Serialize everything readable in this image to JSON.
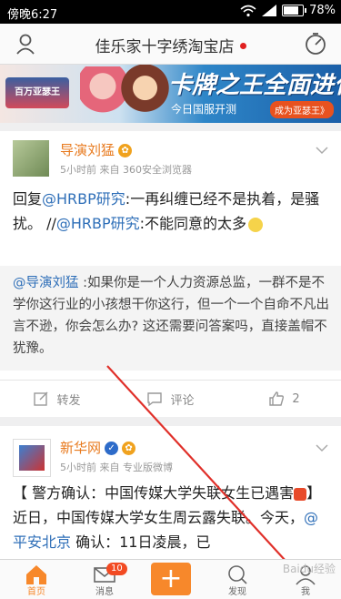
{
  "status_bar": {
    "time": "傍晚6:27",
    "battery": "78%"
  },
  "header": {
    "title": "佳乐家十字绣淘宝店"
  },
  "banner": {
    "logo_text": "百万亚瑟王",
    "title": "卡牌之王全面进化",
    "subtitle": "今日国服开测",
    "tag": "成为亚瑟王》"
  },
  "post1": {
    "author": "导演刘猛",
    "meta": "5小时前  来自 360安全浏览器",
    "text_prefix": "回复",
    "mention1": "@HRBP研究",
    "text_mid": ":一再纠缠已经不是执着，是骚扰。 //",
    "mention2": "@HRBP研究",
    "text_end": ":不能同意的太多",
    "quote_mention": "@导演刘猛",
    "quote_text": " :如果你是一个人力资源总监，一群不是不学你这行业的小孩想干你这行，但一个一个自命不凡出言不逊，你会怎么办? 这还需要问答案吗，直接盖帽不犹豫。",
    "actions": {
      "repost": "转发",
      "comment": "评论",
      "like": "2"
    }
  },
  "post2": {
    "author": "新华网",
    "meta": "5小时前  来自 专业版微博",
    "text_a": "【 警方确认：中国传媒大学失联女生已遇害",
    "text_b": "】近日，中国传媒大学女生周云露失联。今天，",
    "mention": "@平安北京",
    "text_c": " 确认：11日凌晨，已"
  },
  "tabbar": {
    "home": "首页",
    "messages": "消息",
    "messages_badge": "10",
    "discover": "发现",
    "me": "我"
  },
  "watermark": "Baidu经验",
  "colors": {
    "accent": "#e87a1e",
    "link": "#2f6fb8",
    "badge": "#f24a22",
    "plus": "#f7882b"
  }
}
